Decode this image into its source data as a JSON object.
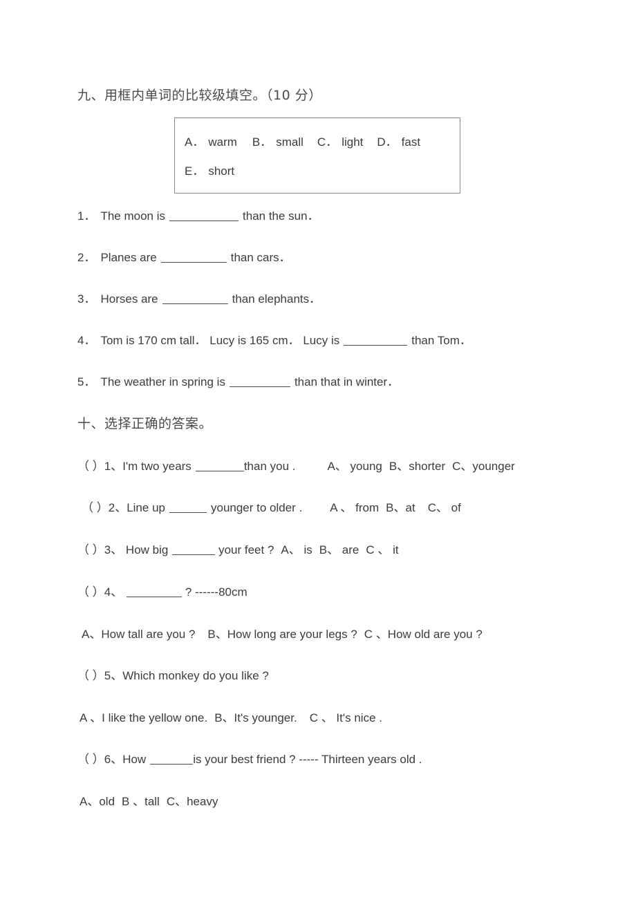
{
  "document": {
    "type": "english-worksheet",
    "text_color": "#3c3c3c",
    "background_color": "#ffffff",
    "border_color": "#8a8a8a"
  },
  "section_nine": {
    "heading": "九、用框内单词的比较级填空。（10 分）",
    "word_bank": {
      "row1": [
        {
          "letter": "A．",
          "word": "warm"
        },
        {
          "letter": "B．",
          "word": "small"
        },
        {
          "letter": "C．",
          "word": "light"
        },
        {
          "letter": "D．",
          "word": "fast"
        }
      ],
      "row2": [
        {
          "letter": "E．",
          "word": "short"
        }
      ]
    },
    "items": [
      {
        "number": "1．",
        "before": "The moon is",
        "blank_width": "w100",
        "after": "than the sun．"
      },
      {
        "number": "2．",
        "before": "Planes are",
        "blank_width": "w95",
        "after": "than cars．"
      },
      {
        "number": "3．",
        "before": "Horses are",
        "blank_width": "w95",
        "after": "than elephants．"
      },
      {
        "number": "4．",
        "before": "Tom is 170 cm tall．  Lucy is 165 cm．  Lucy is",
        "blank_width": "w92",
        "after": "than Tom．"
      },
      {
        "number": "5．",
        "before": "The weather in spring is",
        "blank_width": "w88",
        "after": "than that in winter．"
      }
    ]
  },
  "section_ten": {
    "heading": "十、选择正确的答案。",
    "questions": [
      {
        "paren": "（ ）",
        "number": "1、",
        "stem_before": "I'm two years",
        "blank_width": "w70",
        "stem_after": "than you .",
        "options_inline": [
          "A、 young",
          "B、shorter",
          "C、younger"
        ]
      },
      {
        "paren": "（ ）",
        "number": "2、",
        "stem_before": "Line up",
        "blank_width": "w54",
        "stem_after": "younger to  older .",
        "options_inline": [
          "A 、 from",
          "B、at",
          "C、 of"
        ]
      },
      {
        "paren": "（ ）",
        "number": "3、",
        "stem_before": " How  big",
        "blank_width": "w62",
        "stem_after": " your feet ?",
        "options_inline": [
          "A、 is",
          "B、 are",
          "C 、 it"
        ]
      },
      {
        "paren": "（ ）",
        "number": "4、",
        "stem_before": "",
        "blank_width": "w80",
        "stem_after": " ?   ------80cm",
        "options_below": [
          "A、How tall are you ?",
          "B、How long are your legs ?",
          "C 、How old are you ?"
        ]
      },
      {
        "paren": "（ ）",
        "number": "5、",
        "stem_before": "Which monkey do you like ?",
        "blank_width": "",
        "stem_after": "",
        "options_below": [
          "A 、I like the yellow one.",
          "B、It's younger.",
          "C 、 It's nice ."
        ]
      },
      {
        "paren": "（ ）",
        "number": "6、",
        "stem_before": "How",
        "blank_width": "w62",
        "stem_after": "is your best friend ?   ----- Thirteen years old .",
        "options_below": [
          "A、old",
          "B 、tall",
          "C、heavy"
        ]
      }
    ]
  }
}
